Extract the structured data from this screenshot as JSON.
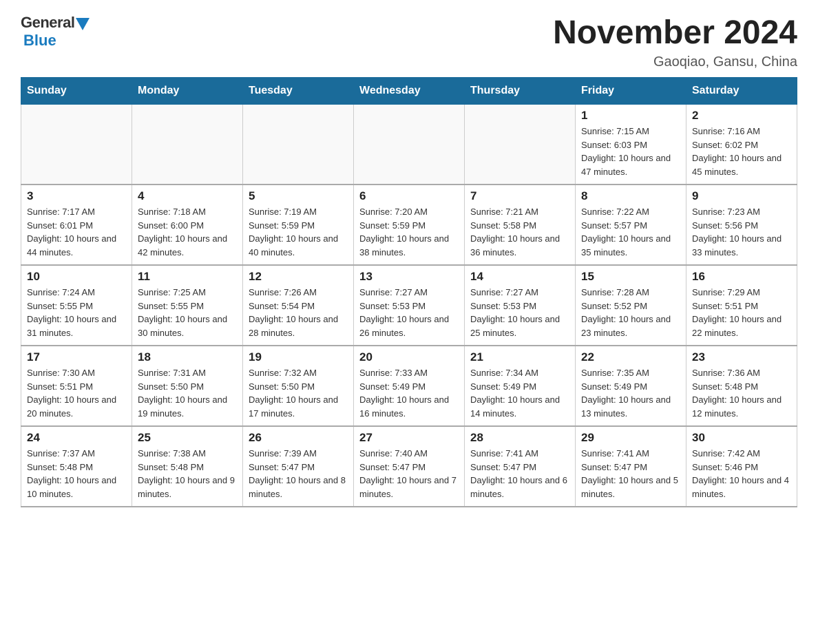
{
  "header": {
    "logo_general": "General",
    "logo_blue": "Blue",
    "month_title": "November 2024",
    "location": "Gaoqiao, Gansu, China"
  },
  "weekdays": [
    "Sunday",
    "Monday",
    "Tuesday",
    "Wednesday",
    "Thursday",
    "Friday",
    "Saturday"
  ],
  "weeks": [
    [
      {
        "day": "",
        "info": ""
      },
      {
        "day": "",
        "info": ""
      },
      {
        "day": "",
        "info": ""
      },
      {
        "day": "",
        "info": ""
      },
      {
        "day": "",
        "info": ""
      },
      {
        "day": "1",
        "info": "Sunrise: 7:15 AM\nSunset: 6:03 PM\nDaylight: 10 hours and 47 minutes."
      },
      {
        "day": "2",
        "info": "Sunrise: 7:16 AM\nSunset: 6:02 PM\nDaylight: 10 hours and 45 minutes."
      }
    ],
    [
      {
        "day": "3",
        "info": "Sunrise: 7:17 AM\nSunset: 6:01 PM\nDaylight: 10 hours and 44 minutes."
      },
      {
        "day": "4",
        "info": "Sunrise: 7:18 AM\nSunset: 6:00 PM\nDaylight: 10 hours and 42 minutes."
      },
      {
        "day": "5",
        "info": "Sunrise: 7:19 AM\nSunset: 5:59 PM\nDaylight: 10 hours and 40 minutes."
      },
      {
        "day": "6",
        "info": "Sunrise: 7:20 AM\nSunset: 5:59 PM\nDaylight: 10 hours and 38 minutes."
      },
      {
        "day": "7",
        "info": "Sunrise: 7:21 AM\nSunset: 5:58 PM\nDaylight: 10 hours and 36 minutes."
      },
      {
        "day": "8",
        "info": "Sunrise: 7:22 AM\nSunset: 5:57 PM\nDaylight: 10 hours and 35 minutes."
      },
      {
        "day": "9",
        "info": "Sunrise: 7:23 AM\nSunset: 5:56 PM\nDaylight: 10 hours and 33 minutes."
      }
    ],
    [
      {
        "day": "10",
        "info": "Sunrise: 7:24 AM\nSunset: 5:55 PM\nDaylight: 10 hours and 31 minutes."
      },
      {
        "day": "11",
        "info": "Sunrise: 7:25 AM\nSunset: 5:55 PM\nDaylight: 10 hours and 30 minutes."
      },
      {
        "day": "12",
        "info": "Sunrise: 7:26 AM\nSunset: 5:54 PM\nDaylight: 10 hours and 28 minutes."
      },
      {
        "day": "13",
        "info": "Sunrise: 7:27 AM\nSunset: 5:53 PM\nDaylight: 10 hours and 26 minutes."
      },
      {
        "day": "14",
        "info": "Sunrise: 7:27 AM\nSunset: 5:53 PM\nDaylight: 10 hours and 25 minutes."
      },
      {
        "day": "15",
        "info": "Sunrise: 7:28 AM\nSunset: 5:52 PM\nDaylight: 10 hours and 23 minutes."
      },
      {
        "day": "16",
        "info": "Sunrise: 7:29 AM\nSunset: 5:51 PM\nDaylight: 10 hours and 22 minutes."
      }
    ],
    [
      {
        "day": "17",
        "info": "Sunrise: 7:30 AM\nSunset: 5:51 PM\nDaylight: 10 hours and 20 minutes."
      },
      {
        "day": "18",
        "info": "Sunrise: 7:31 AM\nSunset: 5:50 PM\nDaylight: 10 hours and 19 minutes."
      },
      {
        "day": "19",
        "info": "Sunrise: 7:32 AM\nSunset: 5:50 PM\nDaylight: 10 hours and 17 minutes."
      },
      {
        "day": "20",
        "info": "Sunrise: 7:33 AM\nSunset: 5:49 PM\nDaylight: 10 hours and 16 minutes."
      },
      {
        "day": "21",
        "info": "Sunrise: 7:34 AM\nSunset: 5:49 PM\nDaylight: 10 hours and 14 minutes."
      },
      {
        "day": "22",
        "info": "Sunrise: 7:35 AM\nSunset: 5:49 PM\nDaylight: 10 hours and 13 minutes."
      },
      {
        "day": "23",
        "info": "Sunrise: 7:36 AM\nSunset: 5:48 PM\nDaylight: 10 hours and 12 minutes."
      }
    ],
    [
      {
        "day": "24",
        "info": "Sunrise: 7:37 AM\nSunset: 5:48 PM\nDaylight: 10 hours and 10 minutes."
      },
      {
        "day": "25",
        "info": "Sunrise: 7:38 AM\nSunset: 5:48 PM\nDaylight: 10 hours and 9 minutes."
      },
      {
        "day": "26",
        "info": "Sunrise: 7:39 AM\nSunset: 5:47 PM\nDaylight: 10 hours and 8 minutes."
      },
      {
        "day": "27",
        "info": "Sunrise: 7:40 AM\nSunset: 5:47 PM\nDaylight: 10 hours and 7 minutes."
      },
      {
        "day": "28",
        "info": "Sunrise: 7:41 AM\nSunset: 5:47 PM\nDaylight: 10 hours and 6 minutes."
      },
      {
        "day": "29",
        "info": "Sunrise: 7:41 AM\nSunset: 5:47 PM\nDaylight: 10 hours and 5 minutes."
      },
      {
        "day": "30",
        "info": "Sunrise: 7:42 AM\nSunset: 5:46 PM\nDaylight: 10 hours and 4 minutes."
      }
    ]
  ]
}
